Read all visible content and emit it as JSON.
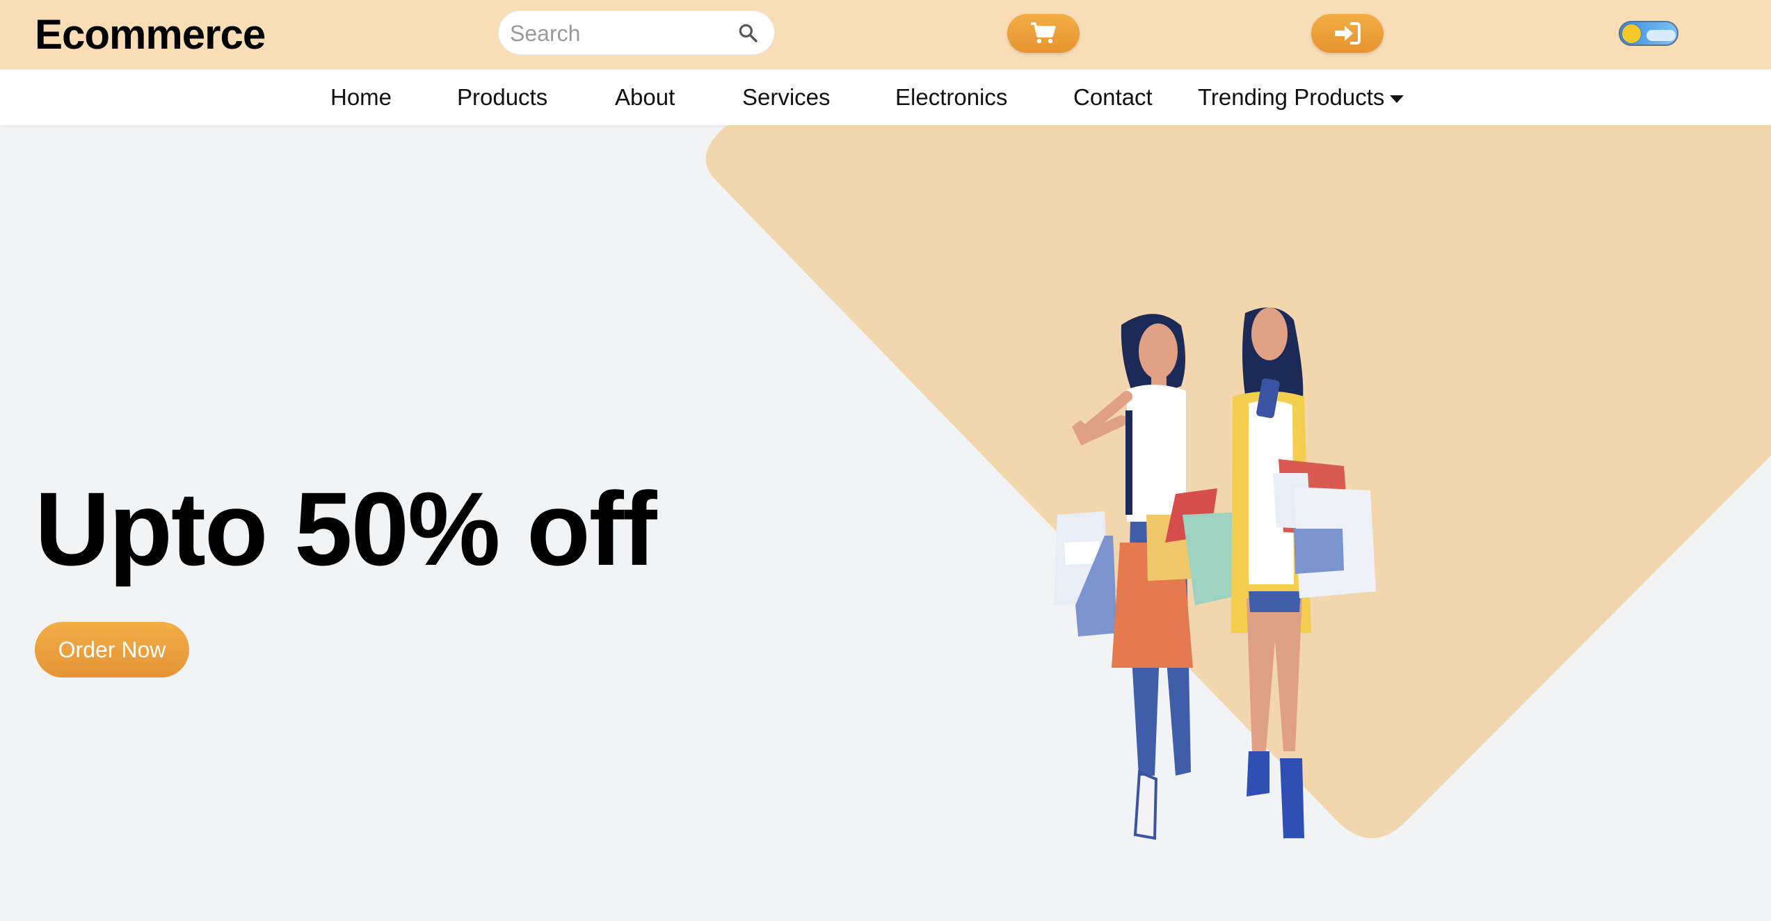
{
  "header": {
    "logo": "Ecommerce",
    "search_placeholder": "Search",
    "icons": {
      "search": "search-icon",
      "cart": "cart-icon",
      "login": "sign-in-icon",
      "theme": "theme-toggle"
    },
    "background": "#f9ddb6",
    "accent": "#efa33e"
  },
  "nav": {
    "items": [
      {
        "label": "Home"
      },
      {
        "label": "Products"
      },
      {
        "label": "About"
      },
      {
        "label": "Services"
      },
      {
        "label": "Electronics"
      },
      {
        "label": "Contact"
      },
      {
        "label": "Trending Products"
      }
    ]
  },
  "hero": {
    "headline": "Upto 50% off",
    "cta": "Order Now",
    "shape_color": "#f2d6ad",
    "page_background": "#f2f3f5"
  }
}
